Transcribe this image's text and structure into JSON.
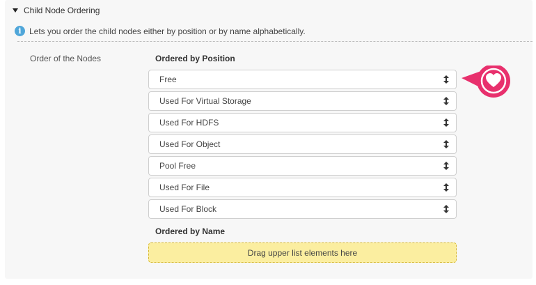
{
  "section": {
    "title": "Child Node Ordering"
  },
  "info": {
    "text": "Lets you order the child nodes either by position or by name alphabetically."
  },
  "field": {
    "label": "Order of the Nodes"
  },
  "by_position": {
    "title": "Ordered by Position",
    "items": [
      {
        "label": "Free"
      },
      {
        "label": "Used For Virtual Storage"
      },
      {
        "label": "Used For HDFS"
      },
      {
        "label": "Used For Object"
      },
      {
        "label": "Pool Free"
      },
      {
        "label": "Used For File"
      },
      {
        "label": "Used For Block"
      }
    ]
  },
  "by_name": {
    "title": "Ordered by Name",
    "dropzone": "Drag upper list elements here"
  },
  "colors": {
    "info": "#4fa6d9",
    "dropzone_bg": "#fbeea0",
    "badge": "#e8306d"
  },
  "icons": {
    "collapse": "caret-down-icon",
    "info": "info-icon",
    "sort": "sort-icon",
    "favorite": "heart-icon"
  }
}
